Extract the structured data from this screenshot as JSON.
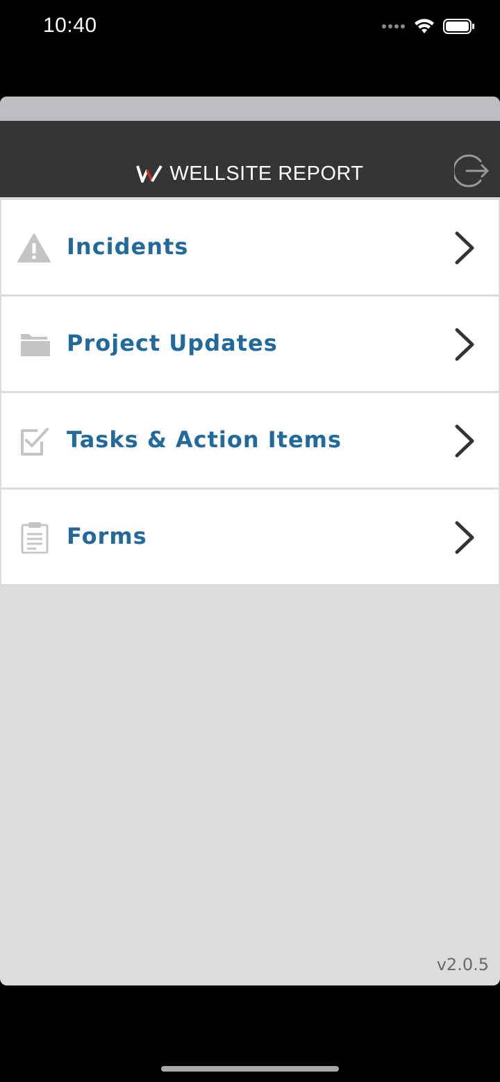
{
  "status_bar": {
    "time": "10:40"
  },
  "header": {
    "title": "WELLSITE REPORT",
    "logo_icon": "wellsite-w-logo-icon",
    "logout_icon": "logout-icon"
  },
  "menu": {
    "items": [
      {
        "label": "Incidents",
        "icon": "warning-icon"
      },
      {
        "label": "Project Updates",
        "icon": "folder-icon"
      },
      {
        "label": "Tasks & Action Items",
        "icon": "checkbox-icon"
      },
      {
        "label": "Forms",
        "icon": "clipboard-icon"
      }
    ]
  },
  "footer": {
    "version": "v2.0.5"
  },
  "colors": {
    "header_bg": "#353535",
    "label_blue": "#236a9c",
    "page_bg": "#dcdcdc",
    "logo_red": "#c8281e"
  }
}
